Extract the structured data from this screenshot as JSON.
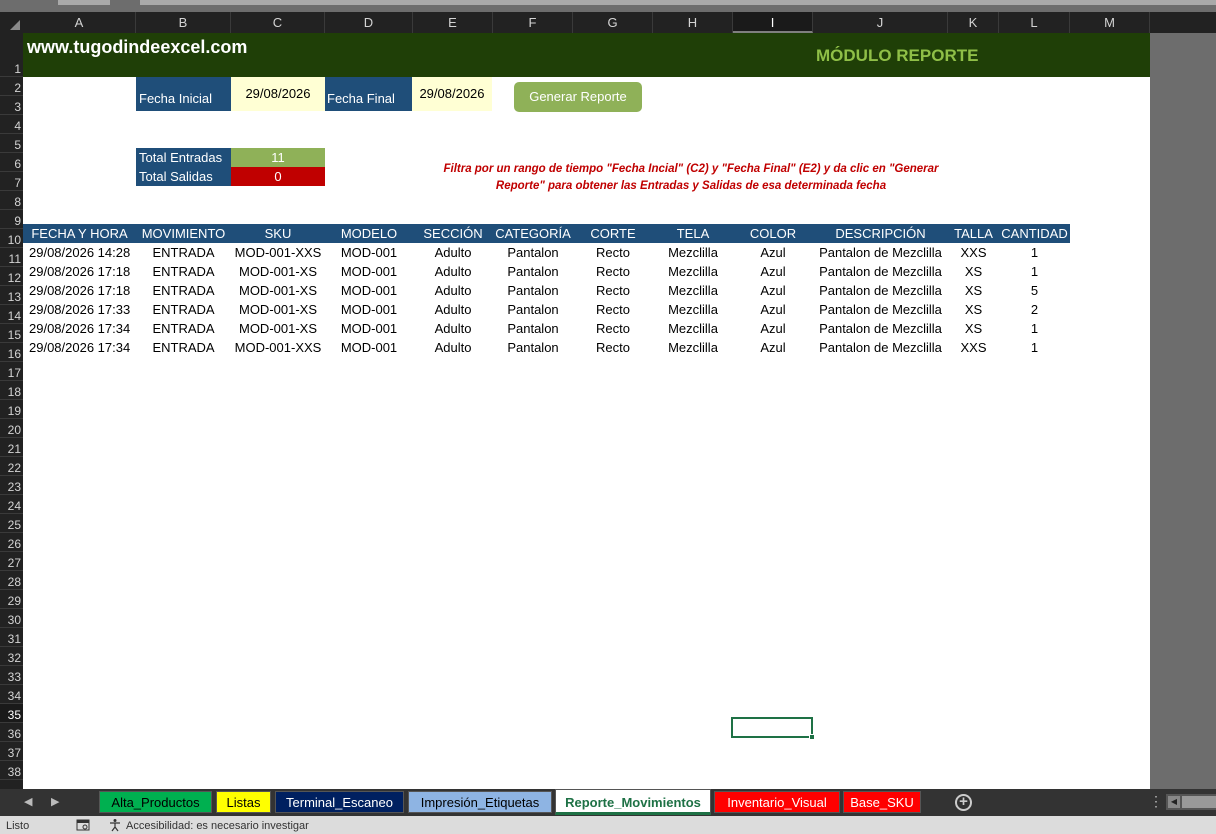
{
  "columns": [
    "A",
    "B",
    "C",
    "D",
    "E",
    "F",
    "G",
    "H",
    "I",
    "J",
    "K",
    "L",
    "M"
  ],
  "selected_column": "I",
  "rows": [
    "1",
    "2",
    "3",
    "4",
    "5",
    "6",
    "7",
    "8",
    "9",
    "10",
    "11",
    "12",
    "13",
    "14",
    "15",
    "16",
    "17",
    "18",
    "19",
    "20",
    "21",
    "22",
    "23",
    "24",
    "25",
    "26",
    "27",
    "28",
    "29",
    "30",
    "31",
    "32",
    "33",
    "34",
    "35",
    "36",
    "37",
    "38"
  ],
  "selected_row": "35",
  "banner": {
    "site": "www.tugodindeexcel.com",
    "title": "MÓDULO REPORTE"
  },
  "filters": {
    "start_label": "Fecha Inicial",
    "start_value": "29/08/2026",
    "end_label": "Fecha Final",
    "end_value": "29/08/2026",
    "generate_button": "Generar Reporte"
  },
  "totals": {
    "entries_label": "Total Entradas",
    "entries_value": "11",
    "exits_label": "Total Salidas",
    "exits_value": "0"
  },
  "instructions": "Filtra por un rango de tiempo \"Fecha Incial\" (C2) y \"Fecha Final\" (E2) y da clic en \"Generar Reporte\" para obtener las Entradas y Salidas de esa determinada fecha",
  "table": {
    "headers": [
      "FECHA Y HORA",
      "MOVIMIENTO",
      "SKU",
      "MODELO",
      "SECCIÓN",
      "CATEGORÍA",
      "CORTE",
      "TELA",
      "COLOR",
      "DESCRIPCIÓN",
      "TALLA",
      "CANTIDAD"
    ],
    "rows": [
      [
        "29/08/2026 14:28",
        "ENTRADA",
        "MOD-001-XXS",
        "MOD-001",
        "Adulto",
        "Pantalon",
        "Recto",
        "Mezclilla",
        "Azul",
        "Pantalon de Mezclilla",
        "XXS",
        "1"
      ],
      [
        "29/08/2026 17:18",
        "ENTRADA",
        "MOD-001-XS",
        "MOD-001",
        "Adulto",
        "Pantalon",
        "Recto",
        "Mezclilla",
        "Azul",
        "Pantalon de Mezclilla",
        "XS",
        "1"
      ],
      [
        "29/08/2026 17:18",
        "ENTRADA",
        "MOD-001-XS",
        "MOD-001",
        "Adulto",
        "Pantalon",
        "Recto",
        "Mezclilla",
        "Azul",
        "Pantalon de Mezclilla",
        "XS",
        "5"
      ],
      [
        "29/08/2026 17:33",
        "ENTRADA",
        "MOD-001-XS",
        "MOD-001",
        "Adulto",
        "Pantalon",
        "Recto",
        "Mezclilla",
        "Azul",
        "Pantalon de Mezclilla",
        "XS",
        "2"
      ],
      [
        "29/08/2026 17:34",
        "ENTRADA",
        "MOD-001-XS",
        "MOD-001",
        "Adulto",
        "Pantalon",
        "Recto",
        "Mezclilla",
        "Azul",
        "Pantalon de Mezclilla",
        "XS",
        "1"
      ],
      [
        "29/08/2026 17:34",
        "ENTRADA",
        "MOD-001-XXS",
        "MOD-001",
        "Adulto",
        "Pantalon",
        "Recto",
        "Mezclilla",
        "Azul",
        "Pantalon de Mezclilla",
        "XXS",
        "1"
      ]
    ]
  },
  "sheet_tabs": [
    {
      "label": "Alta_Productos",
      "color": "#00b050"
    },
    {
      "label": "Listas",
      "color": "#ffff00"
    },
    {
      "label": "Terminal_Escaneo",
      "color": "#002060"
    },
    {
      "label": "Impresión_Etiquetas",
      "color": "#8eb4e3"
    },
    {
      "label": "Reporte_Movimientos",
      "color": "#ffffff",
      "active": true
    },
    {
      "label": "Inventario_Visual",
      "color": "#ff0000"
    },
    {
      "label": "Base_SKU",
      "color": "#ff0000"
    }
  ],
  "status": {
    "ready": "Listo",
    "accessibility": "Accesibilidad: es necesario investigar"
  },
  "colors": {
    "banner": "#1f3f07",
    "header_blue": "#1f4e79",
    "entries_green": "#8fb158",
    "exits_red": "#c00000",
    "date_fill": "#ffffd4",
    "instruction_text": "#c00000"
  }
}
